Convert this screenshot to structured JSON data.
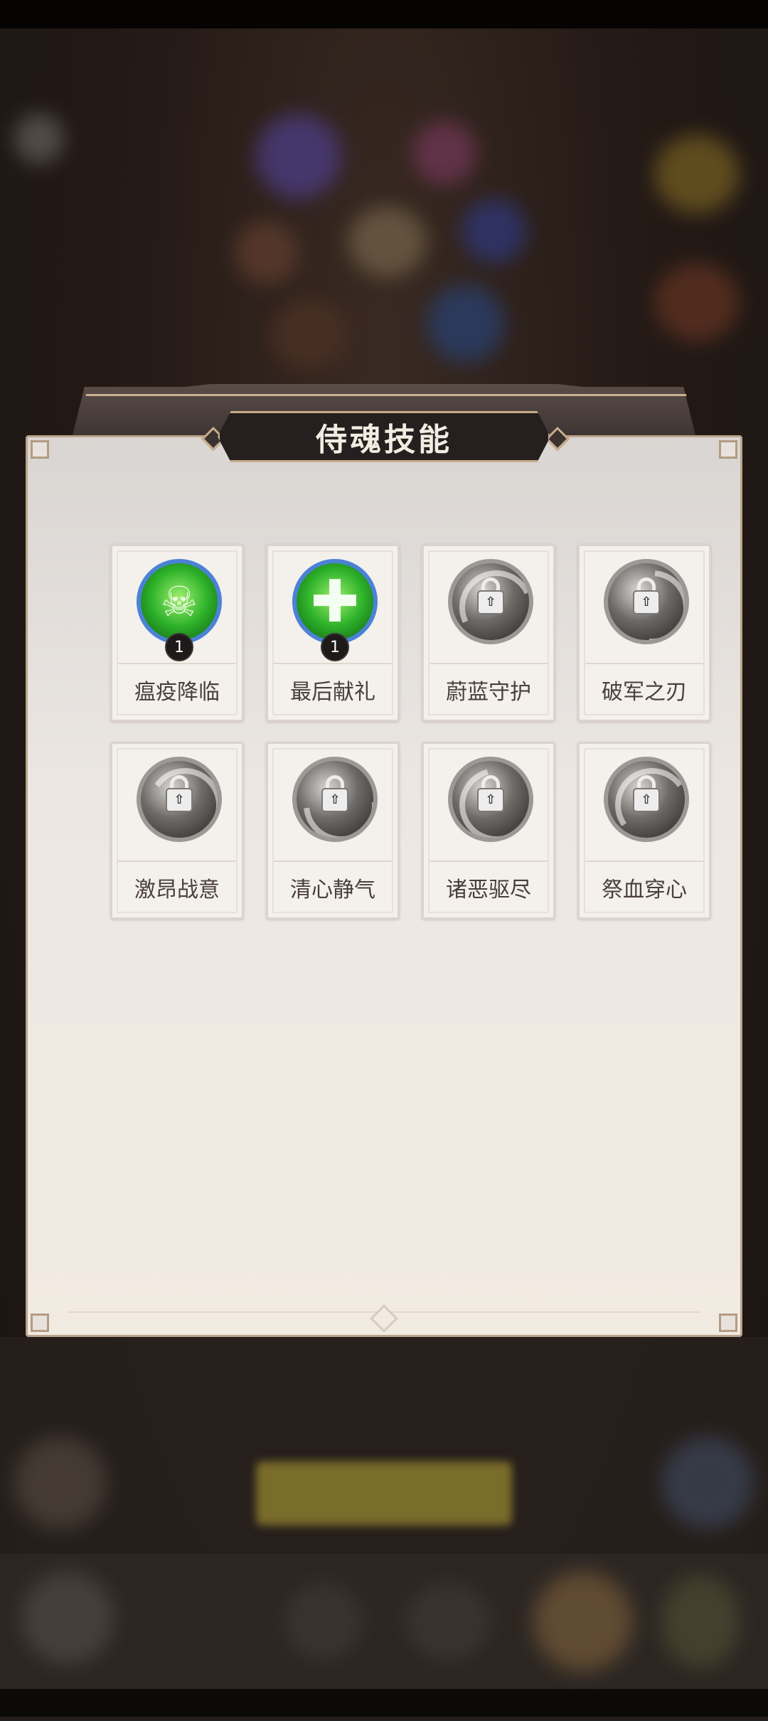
{
  "dialog": {
    "title": "侍魂技能"
  },
  "skills": [
    {
      "name": "瘟疫降临",
      "state": "unlocked",
      "level": "1",
      "icon": "skull-icon"
    },
    {
      "name": "最后献礼",
      "state": "unlocked",
      "level": "1",
      "icon": "plus-cross-icon"
    },
    {
      "name": "蔚蓝守护",
      "state": "locked",
      "icon": "lock-icon"
    },
    {
      "name": "破军之刃",
      "state": "locked",
      "icon": "lock-icon"
    },
    {
      "name": "激昂战意",
      "state": "locked",
      "icon": "lock-icon"
    },
    {
      "name": "清心静气",
      "state": "locked",
      "icon": "lock-icon"
    },
    {
      "name": "诸恶驱尽",
      "state": "locked",
      "icon": "lock-icon"
    },
    {
      "name": "祭血穿心",
      "state": "locked",
      "icon": "lock-icon"
    }
  ],
  "glyphs": {
    "skull": "☠",
    "plus": "✚",
    "lock_arrow": "⇧"
  },
  "colors": {
    "active_ring": "#4b82d6",
    "active_fill": "#2eb12a",
    "locked_fill": "#6e6a67",
    "panel_border": "#b9a58c",
    "title_plate": "#25201f"
  }
}
